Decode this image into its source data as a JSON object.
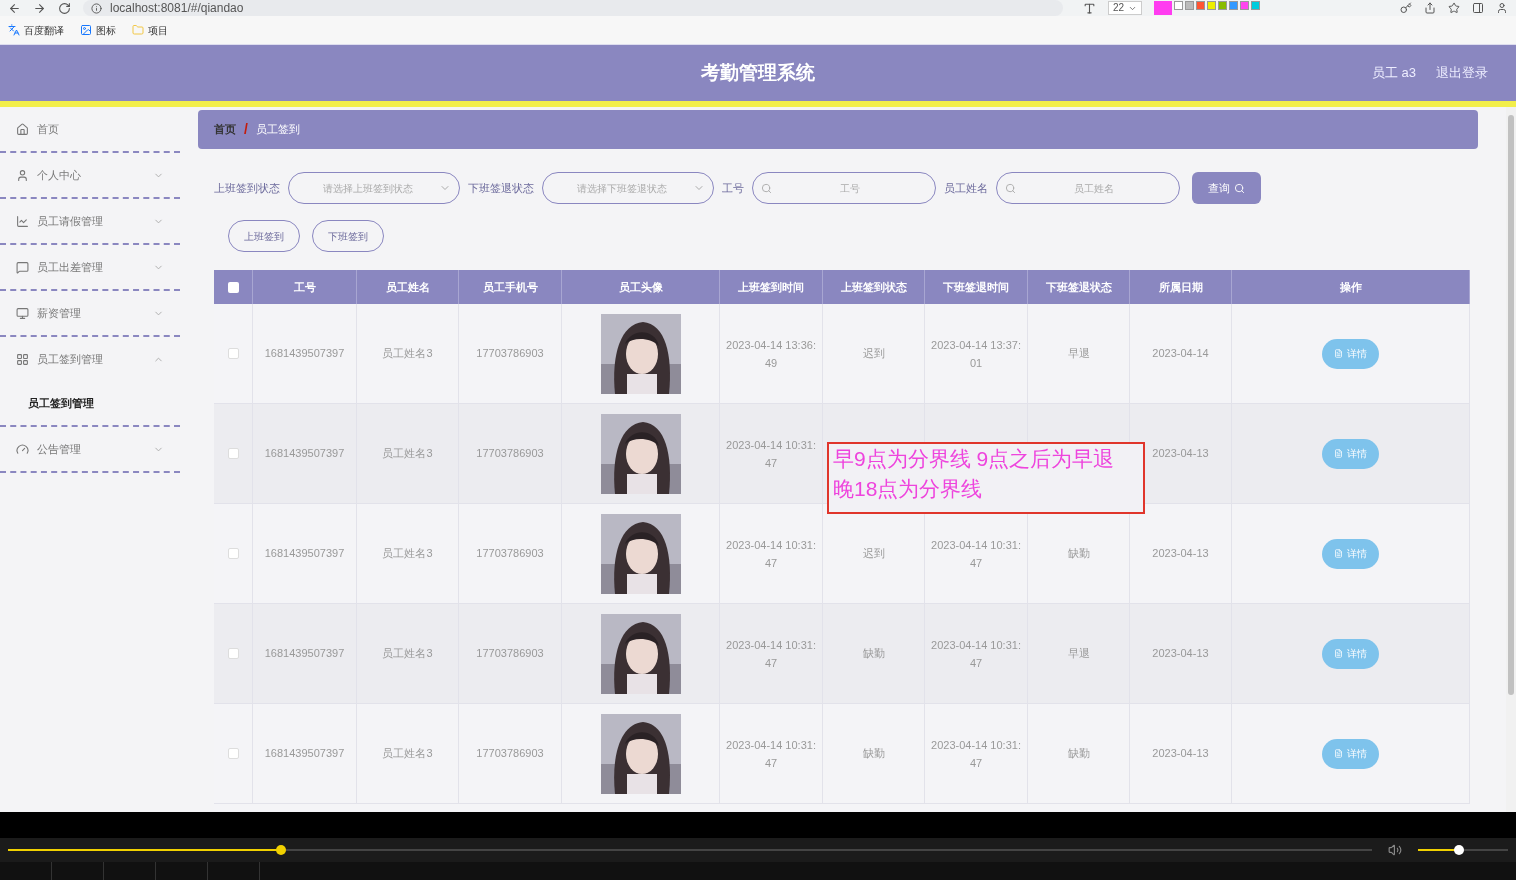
{
  "browser": {
    "url": "localhost:8081/#/qiandao",
    "bookmarks": [
      "百度翻译",
      "图标",
      "项目"
    ],
    "font_size": "22"
  },
  "header": {
    "title": "考勤管理系统",
    "user": "员工 a3",
    "logout": "退出登录"
  },
  "sidebar": {
    "items": [
      {
        "label": "首页",
        "expandable": false
      },
      {
        "label": "个人中心",
        "expandable": true,
        "expanded": false
      },
      {
        "label": "员工请假管理",
        "expandable": true,
        "expanded": false
      },
      {
        "label": "员工出差管理",
        "expandable": true,
        "expanded": false
      },
      {
        "label": "薪资管理",
        "expandable": true,
        "expanded": false
      },
      {
        "label": "员工签到管理",
        "expandable": true,
        "expanded": true,
        "children": [
          {
            "label": "员工签到管理",
            "selected": true
          }
        ]
      },
      {
        "label": "公告管理",
        "expandable": true,
        "expanded": false
      }
    ]
  },
  "breadcrumb": {
    "items": [
      "首页",
      "员工签到"
    ],
    "separator": "/"
  },
  "filters": [
    {
      "label": "上班签到状态",
      "kind": "select",
      "placeholder": "请选择上班签到状态"
    },
    {
      "label": "下班签退状态",
      "kind": "select",
      "placeholder": "请选择下班签退状态"
    },
    {
      "label": "工号",
      "kind": "search",
      "placeholder": "工号"
    },
    {
      "label": "员工姓名",
      "kind": "search",
      "placeholder": "员工姓名"
    }
  ],
  "query_button": "查询",
  "actions": [
    "上班签到",
    "下班签到"
  ],
  "table": {
    "select_all_checked": false,
    "columns": [
      "工号",
      "员工姓名",
      "员工手机号",
      "员工头像",
      "上班签到时间",
      "上班签到状态",
      "下班签退时间",
      "下班签退状态",
      "所属日期",
      "操作"
    ],
    "rows": [
      {
        "checked": false,
        "cells": [
          "1681439507397",
          "员工姓名3",
          "17703786903",
          "",
          "2023-04-14 13:36:49",
          "迟到",
          "2023-04-14 13:37:01",
          "早退",
          "2023-04-14",
          "详情"
        ]
      },
      {
        "checked": false,
        "cells": [
          "1681439507397",
          "员工姓名3",
          "17703786903",
          "",
          "2023-04-14 10:31:47",
          "",
          "",
          "",
          "2023-04-13",
          "详情"
        ]
      },
      {
        "checked": false,
        "cells": [
          "1681439507397",
          "员工姓名3",
          "17703786903",
          "",
          "2023-04-14 10:31:47",
          "迟到",
          "2023-04-14 10:31:47",
          "缺勤",
          "2023-04-13",
          "详情"
        ]
      },
      {
        "checked": false,
        "cells": [
          "1681439507397",
          "员工姓名3",
          "17703786903",
          "",
          "2023-04-14 10:31:47",
          "缺勤",
          "2023-04-14 10:31:47",
          "早退",
          "2023-04-13",
          "详情"
        ]
      },
      {
        "checked": false,
        "cells": [
          "1681439507397",
          "员工姓名3",
          "17703786903",
          "",
          "2023-04-14 10:31:47",
          "缺勤",
          "2023-04-14 10:31:47",
          "缺勤",
          "2023-04-13",
          "详情"
        ]
      }
    ]
  },
  "annotation": {
    "lines": [
      "早9点为分界线 9点之后为早退",
      "晚18点为分界线"
    ]
  },
  "player": {
    "progress": {
      "level": 0.2
    },
    "volume": {
      "level": 0.45
    }
  }
}
